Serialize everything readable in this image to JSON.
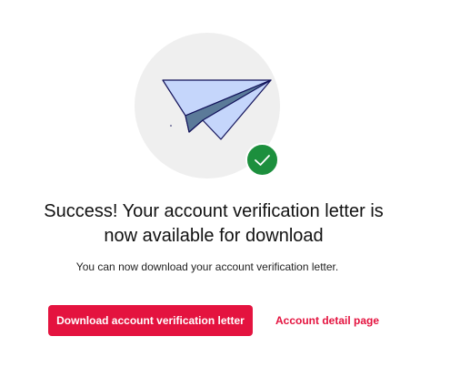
{
  "illustration": {
    "icon": "paper-plane-icon",
    "badge_icon": "check-icon",
    "circle_color": "#efefef",
    "plane_color": "#c5d6fb",
    "plane_shadow_color": "#5b7a99",
    "badge_color": "#1c8f3d"
  },
  "message": {
    "title": "Success! Your account verification letter is now available for download",
    "subtitle": "You can now download your account verification letter."
  },
  "actions": {
    "download_label": "Download account verification letter",
    "detail_link_label": "Account detail page",
    "accent_color": "#e4133f"
  }
}
